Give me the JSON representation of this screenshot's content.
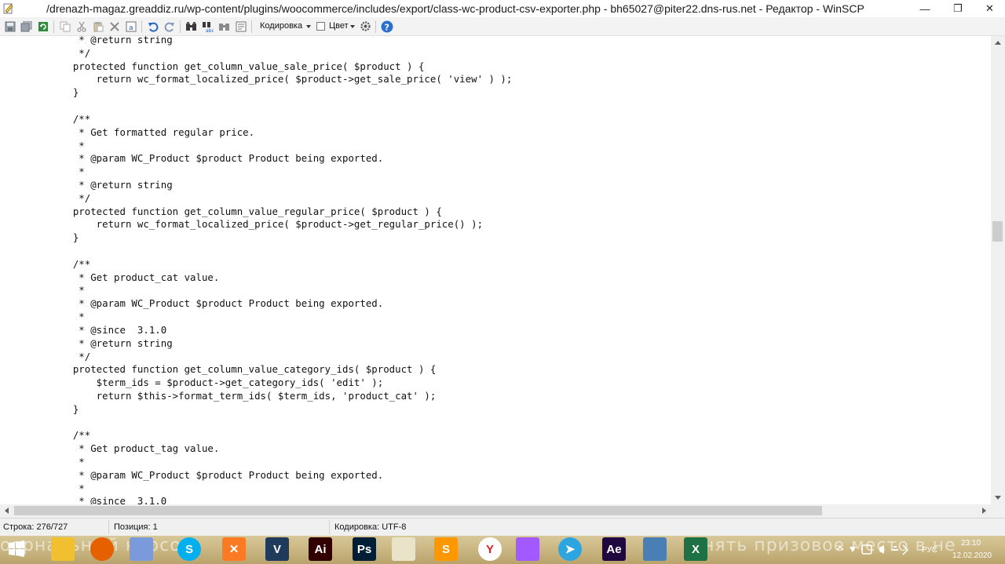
{
  "window": {
    "title": "/drenazh-magaz.greaddiz.ru/wp-content/plugins/woocommerce/includes/export/class-wc-product-csv-exporter.php - bh65027@piter22.dns-rus.net - Редактор - WinSCP",
    "minimize_glyph": "—",
    "maximize_glyph": "❐",
    "close_glyph": "✕"
  },
  "toolbar": {
    "encoding_label": "Кодировка",
    "color_label": "Цвет",
    "color_checked": false,
    "icons": [
      "save-icon",
      "save-all-icon",
      "reload-icon",
      "copy-icon",
      "cut-icon",
      "paste-icon",
      "delete-icon",
      "select-all-icon",
      "undo-icon",
      "redo-icon",
      "find-icon",
      "replace-icon",
      "find-next-icon",
      "goto-line-icon",
      "settings-icon",
      "help-icon"
    ]
  },
  "editor": {
    "lines": [
      "     * @return string",
      "     */",
      "    protected function get_column_value_sale_price( $product ) {",
      "        return wc_format_localized_price( $product->get_sale_price( 'view' ) );",
      "    }",
      "",
      "    /**",
      "     * Get formatted regular price.",
      "     *",
      "     * @param WC_Product $product Product being exported.",
      "     *",
      "     * @return string",
      "     */",
      "    protected function get_column_value_regular_price( $product ) {",
      "        return wc_format_localized_price( $product->get_regular_price() );",
      "    }",
      "",
      "    /**",
      "     * Get product_cat value.",
      "     *",
      "     * @param WC_Product $product Product being exported.",
      "     *",
      "     * @since  3.1.0",
      "     * @return string",
      "     */",
      "    protected function get_column_value_category_ids( $product ) {",
      "        $term_ids = $product->get_category_ids( 'edit' );",
      "        return $this->format_term_ids( $term_ids, 'product_cat' );",
      "    }",
      "",
      "    /**",
      "     * Get product_tag value.",
      "     *",
      "     * @param WC_Product $product Product being exported.",
      "     *",
      "     * @since  3.1.0"
    ]
  },
  "status": {
    "line": "Строка: 276/727",
    "position": "Позиция: 1",
    "encoding": "Кодировка: UTF-8"
  },
  "taskbar": {
    "overlay_left": "оорнальный курсом",
    "overlay_right": "нять призовое место в не",
    "apps": [
      {
        "name": "file-explorer-app",
        "glyph": "",
        "color": "#f0c030"
      },
      {
        "name": "firefox-app",
        "glyph": "",
        "color": "#e66000"
      },
      {
        "name": "paint-app",
        "glyph": "",
        "color": "#7a9adb"
      },
      {
        "name": "skype-app",
        "glyph": "S",
        "color": "#00aff0"
      },
      {
        "name": "xampp-app",
        "glyph": "✕",
        "color": "#fb7a24"
      },
      {
        "name": "visual-studio-app",
        "glyph": "V",
        "color": "#1f3a5a"
      },
      {
        "name": "illustrator-app",
        "glyph": "Ai",
        "color": "#330000"
      },
      {
        "name": "photoshop-app",
        "glyph": "Ps",
        "color": "#001e36"
      },
      {
        "name": "notepad-app",
        "glyph": "",
        "color": "#e9e3c9"
      },
      {
        "name": "sublime-app",
        "glyph": "S",
        "color": "#ff9800"
      },
      {
        "name": "yandex-browser-app",
        "glyph": "Y",
        "color": "#ffffff"
      },
      {
        "name": "figma-app",
        "glyph": "",
        "color": "#a259ff"
      },
      {
        "name": "telegram-app",
        "glyph": "➤",
        "color": "#2ca5e0"
      },
      {
        "name": "after-effects-app",
        "glyph": "Ae",
        "color": "#1f0740"
      },
      {
        "name": "winscp-app",
        "glyph": "",
        "color": "#4a7fb5"
      },
      {
        "name": "excel-app",
        "glyph": "X",
        "color": "#1e7145"
      }
    ],
    "language": "РУС",
    "time": "23:10",
    "date": "12.02.2020"
  }
}
